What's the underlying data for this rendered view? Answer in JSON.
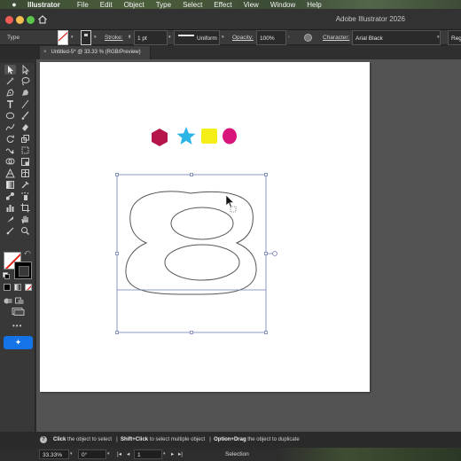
{
  "menubar": {
    "app_name": "Illustrator",
    "items": [
      "File",
      "Edit",
      "Object",
      "Type",
      "Select",
      "Effect",
      "View",
      "Window",
      "Help"
    ]
  },
  "titlebar": {
    "title": "Adobe Illustrator 2026"
  },
  "control": {
    "type_label": "Type",
    "stroke_label": "Stroke:",
    "stroke_value": "1 pt",
    "profile_value": "Uniform",
    "opacity_label": "Opacity:",
    "opacity_value": "100%",
    "character_label": "Character:",
    "font_value": "Arial Black",
    "style_value": "Reg"
  },
  "document_tab": {
    "close_glyph": "×",
    "label": "Untitled-5* @ 33.33 % (RGB/Preview)"
  },
  "artboard": {
    "shapes": [
      {
        "name": "hexagon",
        "color": "#b5174a"
      },
      {
        "name": "star",
        "color": "#2bb5e6"
      },
      {
        "name": "square",
        "color": "#f5ee16"
      },
      {
        "name": "circle",
        "color": "#d8157a"
      }
    ],
    "glyph_outline": "8",
    "outline_color": "#555555",
    "selection_color": "#6f7fb5"
  },
  "tools_panel": {
    "more_glyph": "•••",
    "generative_icon": "✦"
  },
  "status": {
    "help_icon": "?",
    "hint_1_bold": "Click",
    "hint_1": " the object to select",
    "hint_2_bold": "Shift+Click",
    "hint_2": " to select multiple object",
    "hint_3_bold": "Option+Drag",
    "hint_3": " the object to duplicate",
    "separator": "|"
  },
  "infobar": {
    "zoom": "33.33%",
    "rotation": "0°",
    "artboard_number": "1",
    "current_tool": "Selection"
  }
}
